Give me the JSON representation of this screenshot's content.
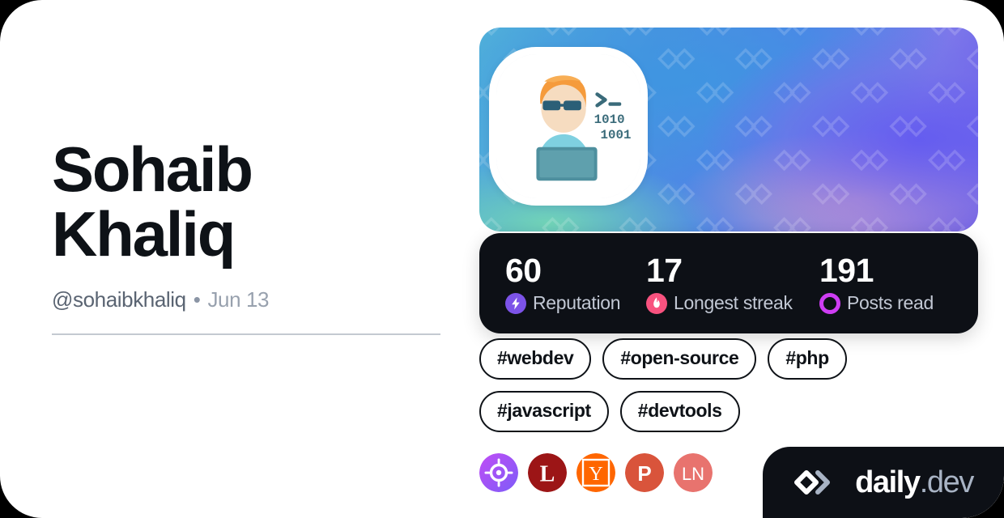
{
  "card": {
    "background": "#ffffff",
    "outer_background": "#000000"
  },
  "profile": {
    "name": "Sohaib\nKhaliq",
    "handle": "@sohaibkhaliq",
    "separator": "•",
    "date": "Jun 13",
    "avatar_alt": "developer-illustration-avatar"
  },
  "cover": {
    "pattern": "daily-dev-chevron-watermark",
    "gradient_colors": [
      "#54b6d8",
      "#4a93df",
      "#4f83e8",
      "#7d78ea",
      "#5b52e8",
      "#78deb0",
      "#edaebc"
    ]
  },
  "stats": {
    "background": "#0d1016",
    "items": [
      {
        "value": "60",
        "label": "Reputation",
        "icon": "bolt-icon",
        "icon_color": "#7c53e8"
      },
      {
        "value": "17",
        "label": "Longest streak",
        "icon": "flame-icon",
        "icon_color": "#f8527f"
      },
      {
        "value": "191",
        "label": "Posts read",
        "icon": "ring-icon",
        "icon_color": "#ce3df3"
      }
    ]
  },
  "tags": [
    {
      "label": "#webdev"
    },
    {
      "label": "#open-source"
    },
    {
      "label": "#php"
    },
    {
      "label": "#javascript"
    },
    {
      "label": "#devtools"
    }
  ],
  "sources": [
    {
      "name": "source-badge-target",
      "glyph": "",
      "color": "#b14ef0",
      "color2": "#8f5cf6"
    },
    {
      "name": "source-badge-lobsters",
      "glyph": "L",
      "color": "#9c1516",
      "color2": "#9c1516"
    },
    {
      "name": "source-badge-hackernews",
      "glyph": "Y",
      "color": "#ff6600",
      "color2": "#ff6600"
    },
    {
      "name": "source-badge-p",
      "glyph": "P",
      "color": "#d9543b",
      "color2": "#d9543b"
    },
    {
      "name": "source-badge-ln",
      "glyph": "LN",
      "color": "#e8736e",
      "color2": "#e8736e"
    }
  ],
  "logo": {
    "name": "daily",
    "suffix": ".dev",
    "mark": "daily-dev-chevron-logo",
    "plate_color": "#0d1016"
  }
}
